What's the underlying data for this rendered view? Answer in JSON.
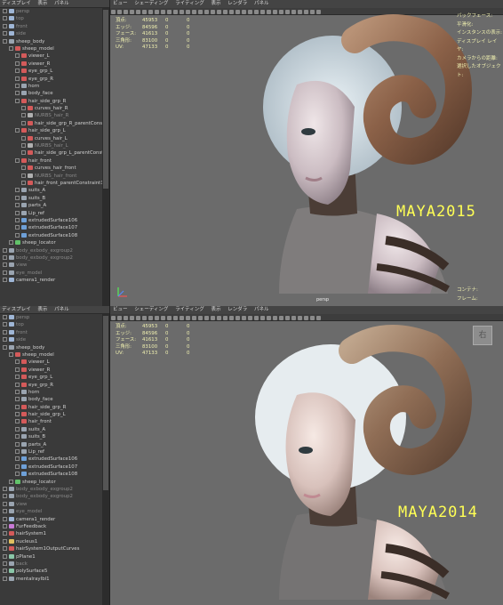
{
  "top_panel": {
    "outliner_menu": [
      "ディスプレイ",
      "表示",
      "パネル"
    ],
    "outliner_items": [
      {
        "label": "persp",
        "type": "cam",
        "indent": 0,
        "dim": true
      },
      {
        "label": "top",
        "type": "cam",
        "indent": 0,
        "dim": true
      },
      {
        "label": "front",
        "type": "cam",
        "indent": 0,
        "dim": true
      },
      {
        "label": "side",
        "type": "cam",
        "indent": 0,
        "dim": true
      },
      {
        "label": "sheep_body",
        "type": "grp",
        "indent": 0
      },
      {
        "label": "sheep_model",
        "type": "hair",
        "indent": 1
      },
      {
        "label": "viewer_L",
        "type": "hair",
        "indent": 2
      },
      {
        "label": "viewer_R",
        "type": "hair",
        "indent": 2
      },
      {
        "label": "eye_grp_L",
        "type": "hair",
        "indent": 2
      },
      {
        "label": "eye_grp_R",
        "type": "hair",
        "indent": 2
      },
      {
        "label": "horn",
        "type": "grp",
        "indent": 2
      },
      {
        "label": "body_face",
        "type": "grp",
        "indent": 2
      },
      {
        "label": "hair_side_grp_R",
        "type": "hair",
        "indent": 2
      },
      {
        "label": "curves_hair_R",
        "type": "hair",
        "indent": 3
      },
      {
        "label": "NURBS_hair_R",
        "type": "nrb",
        "indent": 3,
        "dim": true
      },
      {
        "label": "hair_side_grp_R_parentConst",
        "type": "hair",
        "indent": 3
      },
      {
        "label": "hair_side_grp_L",
        "type": "hair",
        "indent": 2
      },
      {
        "label": "curves_hair_L",
        "type": "hair",
        "indent": 3
      },
      {
        "label": "NURBS_hair_L",
        "type": "nrb",
        "indent": 3,
        "dim": true
      },
      {
        "label": "hair_side_grp_L_parentConst",
        "type": "hair",
        "indent": 3
      },
      {
        "label": "hair_front",
        "type": "hair",
        "indent": 2
      },
      {
        "label": "curves_hair_front",
        "type": "hair",
        "indent": 3
      },
      {
        "label": "NURBS_hair_front",
        "type": "nrb",
        "indent": 3,
        "dim": true
      },
      {
        "label": "hair_front_parentConstraint1",
        "type": "hair",
        "indent": 3
      },
      {
        "label": "suits_A",
        "type": "grp",
        "indent": 2
      },
      {
        "label": "suits_B",
        "type": "grp",
        "indent": 2
      },
      {
        "label": "parts_A",
        "type": "grp",
        "indent": 2
      },
      {
        "label": "Lip_ref",
        "type": "grp",
        "indent": 2
      },
      {
        "label": "extrudedSurface106",
        "type": "surf",
        "indent": 2
      },
      {
        "label": "extrudedSurface107",
        "type": "surf",
        "indent": 2
      },
      {
        "label": "extrudedSurface108",
        "type": "surf",
        "indent": 2
      },
      {
        "label": "sheep_locator",
        "type": "loc",
        "indent": 1
      },
      {
        "label": "body_exbody_exgroup2",
        "type": "grp",
        "indent": 0,
        "dim": true
      },
      {
        "label": "body_exbody_exgroup2",
        "type": "grp",
        "indent": 0,
        "dim": true
      },
      {
        "label": "view",
        "type": "grp",
        "indent": 0,
        "dim": true
      },
      {
        "label": "eye_model",
        "type": "grp",
        "indent": 0,
        "dim": true
      },
      {
        "label": "camera1_render",
        "type": "cam",
        "indent": 0
      }
    ],
    "viewport_menu": [
      "ビュー",
      "シェーディング",
      "ライティング",
      "表示",
      "レンダラ",
      "パネル"
    ],
    "stats": [
      {
        "label": "頂点:",
        "v1": "45953",
        "v2": "0",
        "v3": "0"
      },
      {
        "label": "エッジ:",
        "v1": "84596",
        "v2": "0",
        "v3": "0"
      },
      {
        "label": "フェース:",
        "v1": "41613",
        "v2": "0",
        "v3": "0"
      },
      {
        "label": "三角形:",
        "v1": "83100",
        "v2": "0",
        "v3": "0"
      },
      {
        "label": "UV:",
        "v1": "47133",
        "v2": "0",
        "v3": "0"
      }
    ],
    "hud_right": [
      "バックフェース:",
      "平滑化:",
      "インスタンスの表示:",
      "ディスプレイ レイヤ:",
      "カメラからの距離:",
      "選択したオブジェクト:"
    ],
    "hud_bottom": [
      "コンテナ:",
      "フレーム:"
    ],
    "version_label": "MAYA2015",
    "camera_label": "persp"
  },
  "bottom_panel": {
    "outliner_menu": [
      "ディスプレイ",
      "表示",
      "パネル"
    ],
    "outliner_items": [
      {
        "label": "persp",
        "type": "cam",
        "indent": 0,
        "dim": true
      },
      {
        "label": "top",
        "type": "cam",
        "indent": 0,
        "dim": true
      },
      {
        "label": "front",
        "type": "cam",
        "indent": 0,
        "dim": true
      },
      {
        "label": "side",
        "type": "cam",
        "indent": 0,
        "dim": true
      },
      {
        "label": "sheep_body",
        "type": "grp",
        "indent": 0
      },
      {
        "label": "sheep_model",
        "type": "hair",
        "indent": 1
      },
      {
        "label": "viewer_L",
        "type": "hair",
        "indent": 2
      },
      {
        "label": "viewer_R",
        "type": "hair",
        "indent": 2
      },
      {
        "label": "eye_grp_L",
        "type": "hair",
        "indent": 2
      },
      {
        "label": "eye_grp_R",
        "type": "hair",
        "indent": 2
      },
      {
        "label": "horn",
        "type": "grp",
        "indent": 2
      },
      {
        "label": "body_face",
        "type": "grp",
        "indent": 2
      },
      {
        "label": "hair_side_grp_R",
        "type": "hair",
        "indent": 2
      },
      {
        "label": "hair_side_grp_L",
        "type": "hair",
        "indent": 2
      },
      {
        "label": "hair_front",
        "type": "hair",
        "indent": 2
      },
      {
        "label": "suits_A",
        "type": "grp",
        "indent": 2
      },
      {
        "label": "suits_B",
        "type": "grp",
        "indent": 2
      },
      {
        "label": "parts_A",
        "type": "grp",
        "indent": 2
      },
      {
        "label": "Lip_ref",
        "type": "grp",
        "indent": 2
      },
      {
        "label": "extrudedSurface106",
        "type": "surf",
        "indent": 2
      },
      {
        "label": "extrudedSurface107",
        "type": "surf",
        "indent": 2
      },
      {
        "label": "extrudedSurface108",
        "type": "surf",
        "indent": 2
      },
      {
        "label": "sheep_locator",
        "type": "loc",
        "indent": 1
      },
      {
        "label": "body_exbody_exgroup2",
        "type": "grp",
        "indent": 0,
        "dim": true
      },
      {
        "label": "body_exbody_exgroup2",
        "type": "grp",
        "indent": 0,
        "dim": true
      },
      {
        "label": "view",
        "type": "grp",
        "indent": 0,
        "dim": true
      },
      {
        "label": "eye_model",
        "type": "grp",
        "indent": 0,
        "dim": true
      },
      {
        "label": "camera1_render",
        "type": "cam",
        "indent": 0
      },
      {
        "label": "FurFeedback",
        "type": "fur",
        "indent": 0
      },
      {
        "label": "hairSystem1",
        "type": "hair",
        "indent": 0
      },
      {
        "label": "nucleus1",
        "type": "nuc",
        "indent": 0
      },
      {
        "label": "hairSystem1OutputCurves",
        "type": "hair",
        "indent": 0
      },
      {
        "label": "pPlane1",
        "type": "poly",
        "indent": 0
      },
      {
        "label": "back",
        "type": "grp",
        "indent": 0,
        "dim": true
      },
      {
        "label": "polySurface5",
        "type": "poly",
        "indent": 0
      },
      {
        "label": "mentalrayIbl1",
        "type": "grp",
        "indent": 0
      }
    ],
    "viewport_menu": [
      "ビュー",
      "シェーディング",
      "ライティング",
      "表示",
      "レンダラ",
      "パネル"
    ],
    "stats": [
      {
        "label": "頂点:",
        "v1": "45953",
        "v2": "0",
        "v3": "0"
      },
      {
        "label": "エッジ:",
        "v1": "84596",
        "v2": "0",
        "v3": "0"
      },
      {
        "label": "フェース:",
        "v1": "41613",
        "v2": "0",
        "v3": "0"
      },
      {
        "label": "三角形:",
        "v1": "83100",
        "v2": "0",
        "v3": "0"
      },
      {
        "label": "UV:",
        "v1": "47133",
        "v2": "0",
        "v3": "0"
      }
    ],
    "viewcube_label": "右",
    "version_label": "MAYA2014"
  }
}
